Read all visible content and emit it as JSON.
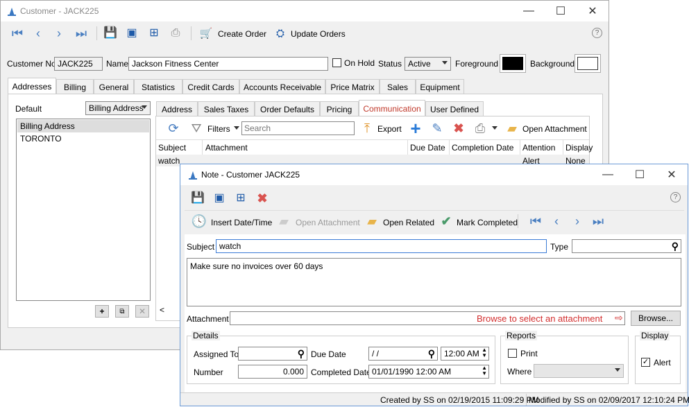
{
  "customer_window": {
    "title": "Customer - JACK225",
    "toolbar": {
      "create_order": "Create Order",
      "update_orders": "Update Orders",
      "help": "?"
    },
    "header": {
      "customer_no_label": "Customer No",
      "customer_no": "JACK225",
      "name_label": "Name",
      "name": "Jackson Fitness Center",
      "on_hold_label": "On Hold",
      "status_label": "Status",
      "status": "Active",
      "foreground_label": "Foreground",
      "background_label": "Background",
      "foreground_color": "#000000",
      "background_color": "#ffffff"
    },
    "tabs": [
      "Addresses",
      "Billing",
      "General",
      "Statistics",
      "Credit Cards",
      "Accounts Receivable",
      "Price Matrix",
      "Sales",
      "Equipment"
    ],
    "addresses": {
      "default_label": "Default",
      "default_value": "Billing Address",
      "list": [
        "Billing Address",
        "TORONTO"
      ],
      "add": "+",
      "copy": "⧉",
      "delete": "✕"
    },
    "subtabs": [
      "Address",
      "Sales Taxes",
      "Order Defaults",
      "Pricing",
      "Communication",
      "User Defined"
    ],
    "comm_toolbar": {
      "filters": "Filters",
      "search_placeholder": "Search",
      "export": "Export",
      "open_attachment": "Open Attachment"
    },
    "grid": {
      "columns": [
        "Subject",
        "Attachment",
        "Due Date",
        "Completion Date",
        "Attention",
        "Display"
      ],
      "rows": [
        {
          "subject": "watch",
          "attachment": "",
          "due_date": "",
          "completion_date": "",
          "attention": "Alert",
          "display": "None"
        }
      ]
    },
    "scroll_left": "<"
  },
  "note_window": {
    "title": "Note - Customer JACK225",
    "toolbar": {
      "insert_datetime": "Insert Date/Time",
      "open_attachment": "Open Attachment",
      "open_related": "Open Related",
      "mark_completed": "Mark Completed",
      "help": "?"
    },
    "subject_label": "Subject",
    "subject": "watch",
    "type_label": "Type",
    "type": "",
    "body": "Make sure no invoices over 60 days",
    "attachment_label": "Attachment",
    "attachment": "",
    "annotation": "Browse to select an attachment",
    "annotation_color": "#d32f2f",
    "browse_button": "Browse...",
    "details": {
      "title": "Details",
      "assigned_to_label": "Assigned To",
      "assigned_to": "",
      "number_label": "Number",
      "number": "0.000",
      "due_date_label": "Due Date",
      "due_date": " / /",
      "due_time": "12:00 AM",
      "completed_date_label": "Completed Date",
      "completed_date": "01/01/1990 12:00 AM"
    },
    "reports": {
      "title": "Reports",
      "print_label": "Print",
      "where_label": "Where",
      "where": ""
    },
    "display": {
      "title": "Display",
      "alert_label": "Alert",
      "alert_checked": "✓"
    },
    "created": "Created by SS on 02/19/2015 11:09:29 PM",
    "modified": "Modified by SS on 02/09/2017 12:10:24 PM"
  }
}
